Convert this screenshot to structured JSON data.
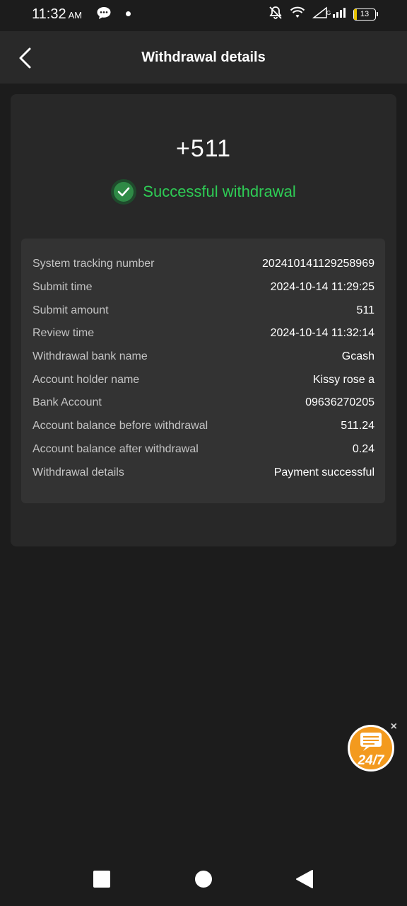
{
  "status_bar": {
    "time": "11:32",
    "ampm": "AM",
    "battery": "13"
  },
  "header": {
    "title": "Withdrawal details"
  },
  "summary": {
    "amount": "+511",
    "status": "Successful withdrawal"
  },
  "details": {
    "rows": [
      {
        "label": "System tracking number",
        "value": "202410141129258969"
      },
      {
        "label": "Submit time",
        "value": "2024-10-14 11:29:25"
      },
      {
        "label": "Submit amount",
        "value": "511"
      },
      {
        "label": "Review time",
        "value": "2024-10-14 11:32:14"
      },
      {
        "label": "Withdrawal bank name",
        "value": "Gcash"
      },
      {
        "label": "Account holder name",
        "value": "Kissy rose a"
      },
      {
        "label": "Bank Account",
        "value": "09636270205"
      },
      {
        "label": "Account balance before withdrawal",
        "value": "511.24"
      },
      {
        "label": "Account balance after withdrawal",
        "value": "0.24"
      },
      {
        "label": "Withdrawal details",
        "value": "Payment successful"
      }
    ]
  },
  "support": {
    "badge": "24/7",
    "close": "×"
  },
  "colors": {
    "success": "#2ecc55",
    "background": "#1c1c1c",
    "card": "#282828",
    "support_orange": "#f39a1e"
  }
}
